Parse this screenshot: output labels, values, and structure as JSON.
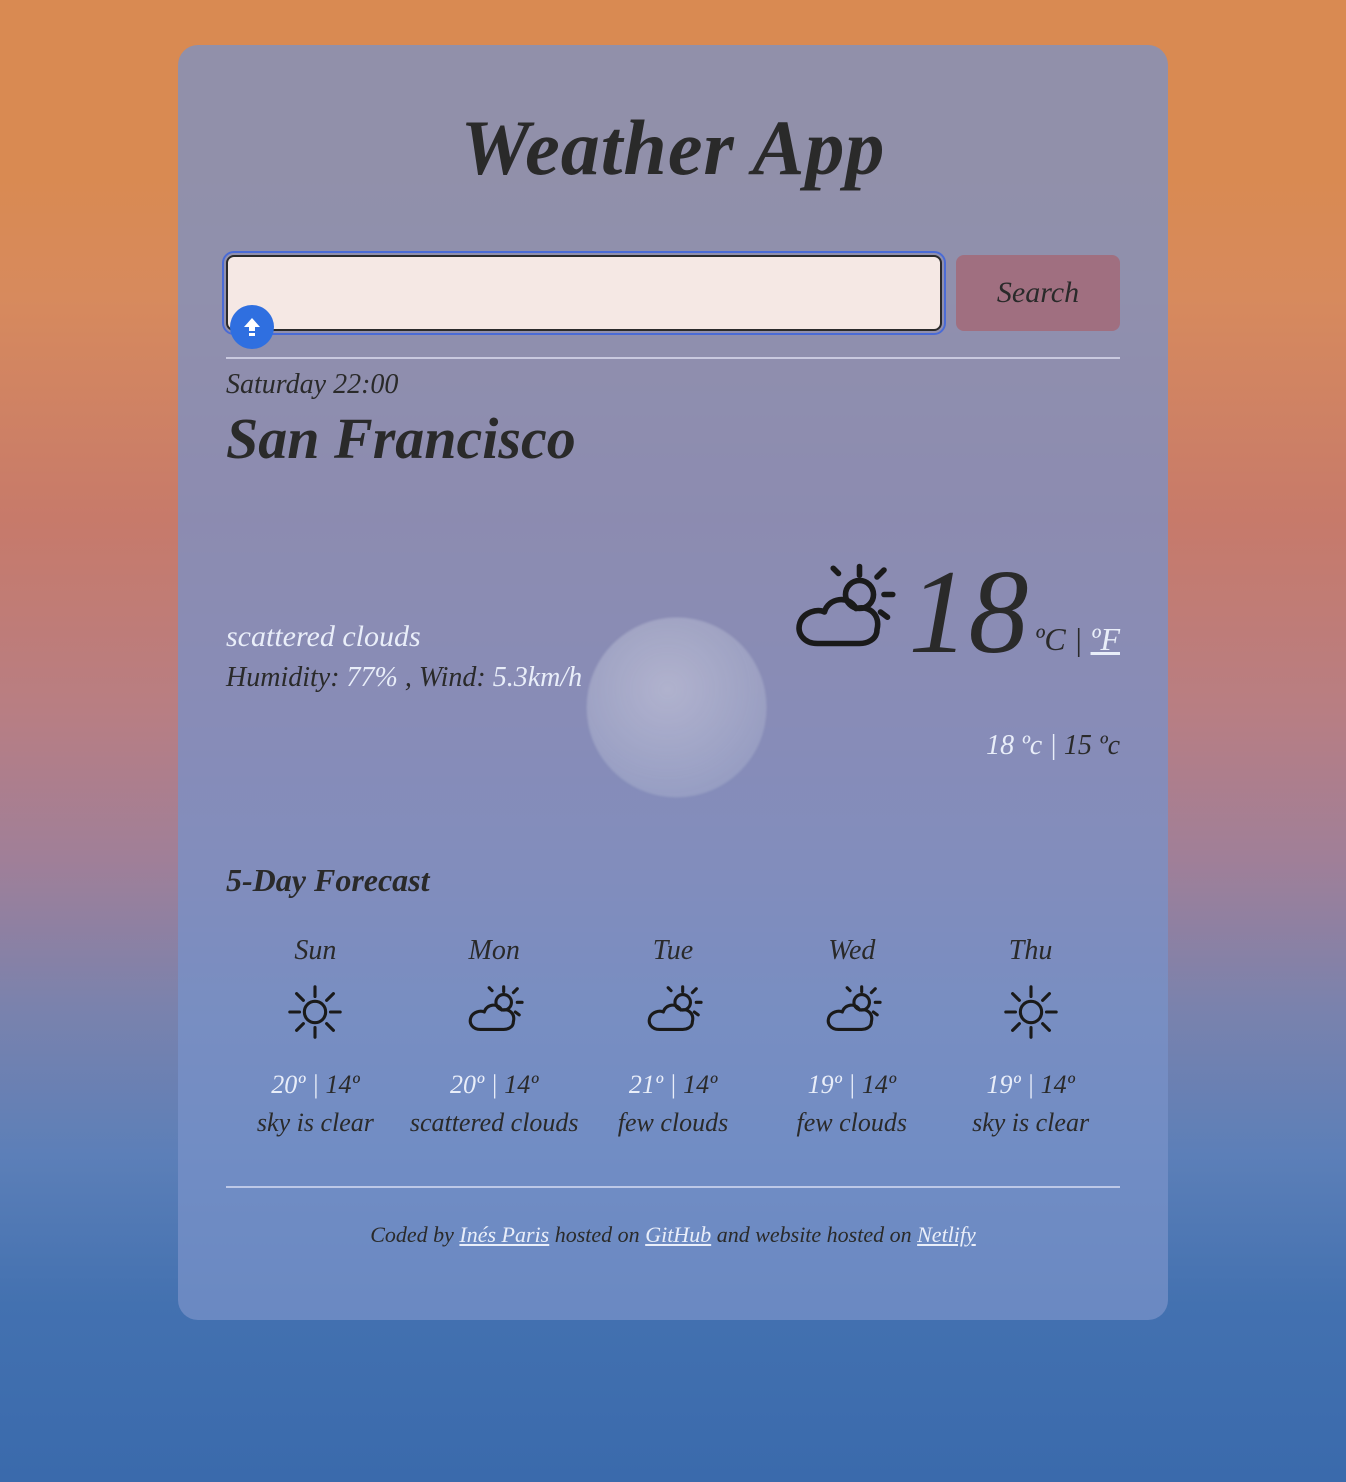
{
  "app": {
    "title": "Weather App"
  },
  "search": {
    "value": "",
    "placeholder": "",
    "button": "Search"
  },
  "current": {
    "datetime": "Saturday 22:00",
    "city": "San Francisco",
    "description": "scattered clouds",
    "humidity_label": "Humidity: ",
    "humidity_value": "77%",
    "wind_label": " , Wind: ",
    "wind_value": "5.3km/h",
    "temp": "18",
    "unit_c_label": "ºC",
    "unit_sep": " | ",
    "unit_f_label": "ºF",
    "high": "18 ºc",
    "hl_sep": " | ",
    "low": "15 ºc",
    "icon": "partly-cloudy"
  },
  "forecast": {
    "title": "5-Day Forecast",
    "days": [
      {
        "name": "Sun",
        "icon": "sunny",
        "hi": "20º",
        "lo": "14º",
        "desc": "sky is clear"
      },
      {
        "name": "Mon",
        "icon": "partly-cloudy",
        "hi": "20º",
        "lo": "14º",
        "desc": "scattered clouds"
      },
      {
        "name": "Tue",
        "icon": "partly-cloudy",
        "hi": "21º",
        "lo": "14º",
        "desc": "few clouds"
      },
      {
        "name": "Wed",
        "icon": "partly-cloudy",
        "hi": "19º",
        "lo": "14º",
        "desc": "few clouds"
      },
      {
        "name": "Thu",
        "icon": "sunny",
        "hi": "19º",
        "lo": "14º",
        "desc": "sky is clear"
      }
    ]
  },
  "footer": {
    "coded_by": "Coded by ",
    "author": "Inés Paris",
    "hosted_on": " hosted on ",
    "repo": "GitHub",
    "and_hosted": " and website hosted on ",
    "host": "Netlify"
  },
  "colors": {
    "accent": "#e9eef9",
    "text": "#2a2a2a",
    "badge": "#2f6fe0"
  }
}
